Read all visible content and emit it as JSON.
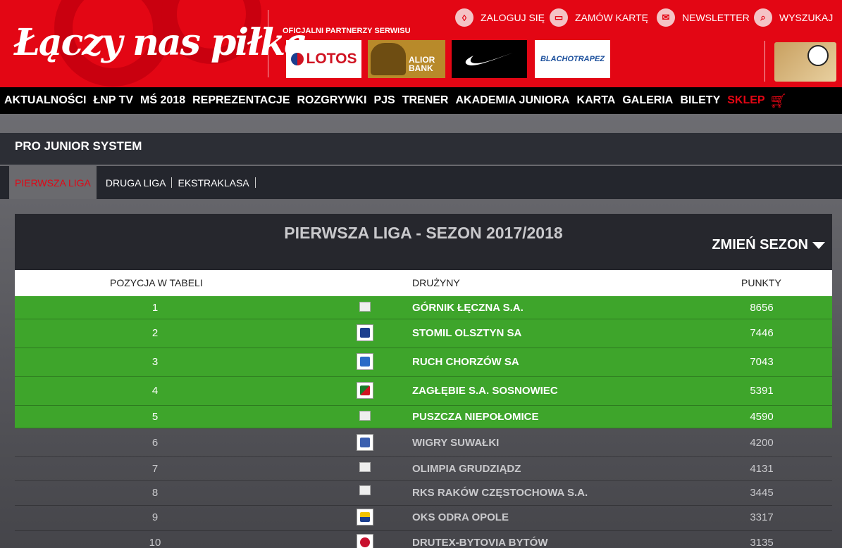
{
  "header": {
    "logo_text": "Łączy nas piłka",
    "partners_label": "OFICJALNI PARTNERZY SERWISU",
    "partners": {
      "lotos": "LOTOS",
      "alior": "ALIOR BANK",
      "blacho": "BLACHOTRAPEZ"
    },
    "top_links": {
      "login": "ZALOGUJ SIĘ",
      "card": "ZAMÓW KARTĘ",
      "newsletter": "NEWSLETTER",
      "search": "WYSZUKAJ"
    }
  },
  "mainnav": {
    "items": [
      "AKTUALNOŚCI",
      "ŁNP TV",
      "MŚ 2018",
      "REPREZENTACJE",
      "ROZGRYWKI",
      "PJS",
      "TRENER",
      "AKADEMIA JUNIORA",
      "KARTA",
      "GALERIA",
      "BILETY"
    ],
    "shop": "SKLEP"
  },
  "section_title": "PRO JUNIOR SYSTEM",
  "tabs": [
    "PIERWSZA LIGA",
    "DRUGA LIGA",
    "EKSTRAKLASA"
  ],
  "table": {
    "title": "PIERWSZA LIGA - SEZON 2017/2018",
    "change_season": "ZMIEŃ SEZON",
    "headers": {
      "pos": "POZYCJA W TABELI",
      "team": "DRUŻYNY",
      "pts": "PUNKTY"
    },
    "rows": [
      {
        "pos": "1",
        "team": "GÓRNIK ŁĘCZNA S.A.",
        "pts": "8656"
      },
      {
        "pos": "2",
        "team": "STOMIL OLSZTYN SA",
        "pts": "7446"
      },
      {
        "pos": "3",
        "team": "RUCH CHORZÓW SA",
        "pts": "7043"
      },
      {
        "pos": "4",
        "team": "ZAGŁĘBIE S.A. SOSNOWIEC",
        "pts": "5391"
      },
      {
        "pos": "5",
        "team": "PUSZCZA NIEPOŁOMICE",
        "pts": "4590"
      },
      {
        "pos": "6",
        "team": "WIGRY SUWAŁKI",
        "pts": "4200"
      },
      {
        "pos": "7",
        "team": "OLIMPIA GRUDZIĄDZ",
        "pts": "4131"
      },
      {
        "pos": "8",
        "team": "RKS RAKÓW CZĘSTOCHOWA S.A.",
        "pts": "3445"
      },
      {
        "pos": "9",
        "team": "OKS ODRA OPOLE",
        "pts": "3317"
      },
      {
        "pos": "10",
        "team": "DRUTEX-BYTOVIA BYTÓW",
        "pts": "3135"
      }
    ]
  },
  "colors": {
    "brand_red": "#e30614",
    "top_row_green": "#3ea52b",
    "nav_black": "#000000"
  }
}
